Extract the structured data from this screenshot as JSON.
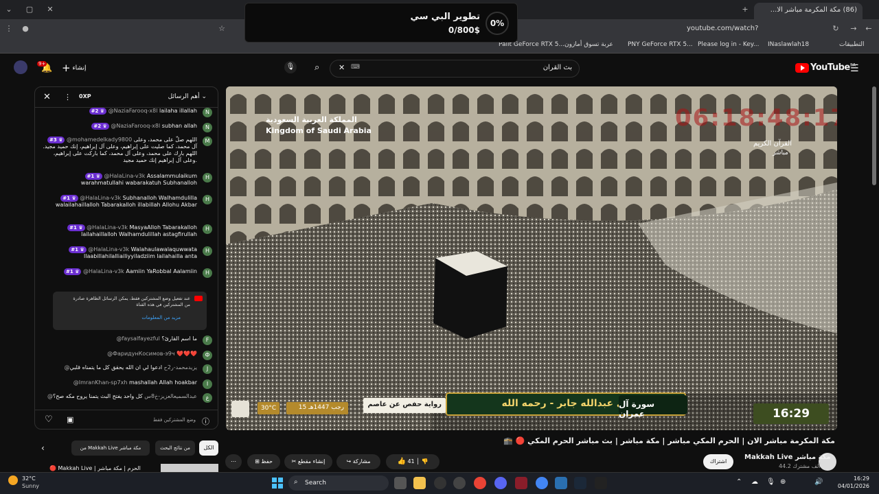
{
  "browser": {
    "tab_title": "(86) مكة المكرمة مباشر الا...",
    "url": "youtube.com/watch?v=6J4ODuaBG1o",
    "bookmarks": [
      "التطبيقات",
      "INaslawlah18",
      "Please log in - Key...",
      "PNY GeForce RTX 5...",
      "عربة تسوق أمازون",
      "Palit GeForce RTX 5..."
    ]
  },
  "popup": {
    "percent": "0%",
    "title": "تطوير البي سي",
    "amount": "0/800$"
  },
  "header": {
    "logo": "YouTube",
    "region": "SA",
    "search_value": "بث القران",
    "create_label": "إنشاء",
    "notif_count": "9+"
  },
  "chat": {
    "title": "أهم الرسائل",
    "points": "0XP",
    "messages": [
      {
        "author": "@NaziaFarooq-x8l",
        "badge": "#2",
        "text": "lailaha illallah",
        "av": "N"
      },
      {
        "author": "@NaziaFarooq-x8l",
        "badge": "#2",
        "text": "subhan allah",
        "av": "N"
      },
      {
        "author": "@mohamedelkady9800",
        "badge": "#3",
        "text": "اللهم صلّ على محمد، وعلى آل محمد، كما صليت على إبراهيم، وعلى آل إبراهيم، إنك حميد مجيد. اللهم بارك على محمد، وعلى آل محمد، كما باركت على إبراهيم، وعلى آل إبراهيم إنك حميد مجيد.",
        "av": "M"
      },
      {
        "author": "@HalaLina-v3k",
        "badge": "#1",
        "text": "Assalammulaikum warahmatullahi wabarakatuh Subhanalloh",
        "av": "H"
      },
      {
        "author": "@HalaLina-v3k",
        "badge": "#1",
        "text": "Subhanalloh Walhamdulilla walailahaillalloh Tabarakalloh illabillah Allohu Akbar",
        "av": "H"
      },
      {
        "author": "@HalaLina-v3k",
        "badge": "#1",
        "text": "MasyaAlloh Tabarakalloh lailahaillalloh Walhamdulillah astagfirullah",
        "av": "H"
      },
      {
        "author": "@HalaLina-v3k",
        "badge": "#1",
        "text": "Walahaulawalaquwwata llaabillahilalliailiyyiladziim lailahailla anta",
        "av": "H"
      },
      {
        "author": "@HalaLina-v3k",
        "badge": "#1",
        "text": "Aamiin YaRobbal Aalamiin",
        "av": "H"
      }
    ],
    "notice": "عند تفعيل وضع المشتركين فقط، يمكن الرسائل الظاهرة صادرة من المشتركين في هذه القناة",
    "notice_link": "مزيد من المعلومات",
    "messages2": [
      {
        "author": "@faysalfayezful",
        "text": "ما اسم القارئ؟",
        "av": "F"
      },
      {
        "author": "@ФаридунКосимов-э9ч",
        "text": "❤️❤️❤️",
        "av": "Ф"
      },
      {
        "author": "@يزيدمحمد-ر2ح",
        "text": "ادعوا لي ان الله يحقق كل ما يتمناه قلبي",
        "av": "J"
      },
      {
        "author": "@ImranKhan-sp7xh",
        "text": "mashallah Allah hoakbar",
        "av": "I"
      },
      {
        "author": "@عبدالسميعالعزيز-خ8س",
        "text": "كل واحد يفتح البث يتمنا يروح مكه صح؟",
        "av": "ع"
      }
    ],
    "input_placeholder": "وضع المشتركين فقط"
  },
  "video": {
    "channel_label_ar": "المملكة العربية السعودية",
    "channel_label_en": "Kingdom of Saudi Arabia",
    "quran_label": "القرآن الكريم",
    "live_label": "مباشر",
    "clock": "06:18:48:17",
    "surah": "سورة آل عمران",
    "reciter": "القارئ : علي عبدالله جابر - رحمه الله",
    "riwaya": "رواية حفص عن عاصم",
    "hijri": "15 رجب 1447هـ",
    "temp": "30°C",
    "time": "16:29"
  },
  "info": {
    "title": "مكة المكرمة مباشر الان | الحرم المكي مباشر | مكة مباشر | بث مباشر الحرم المكي 🔴 🕋",
    "channel": "Makkah Live مكة مباشر",
    "subs": "44.2 ألف مشترك",
    "subscribe": "اشتراك",
    "likes": "41",
    "share": "مشاركة",
    "clip": "إنشاء مقطع",
    "save": "حفظ",
    "filters": [
      "الكل",
      "من نتائج البحث",
      "من Makkah Live مكة مباشر"
    ],
    "playlist_item": "Makkah Live | الحرم | مكة مباشر"
  },
  "taskbar": {
    "temp": "32°C",
    "weather": "Sunny",
    "search": "Search",
    "time": "16:29",
    "date": "04/01/2026"
  }
}
